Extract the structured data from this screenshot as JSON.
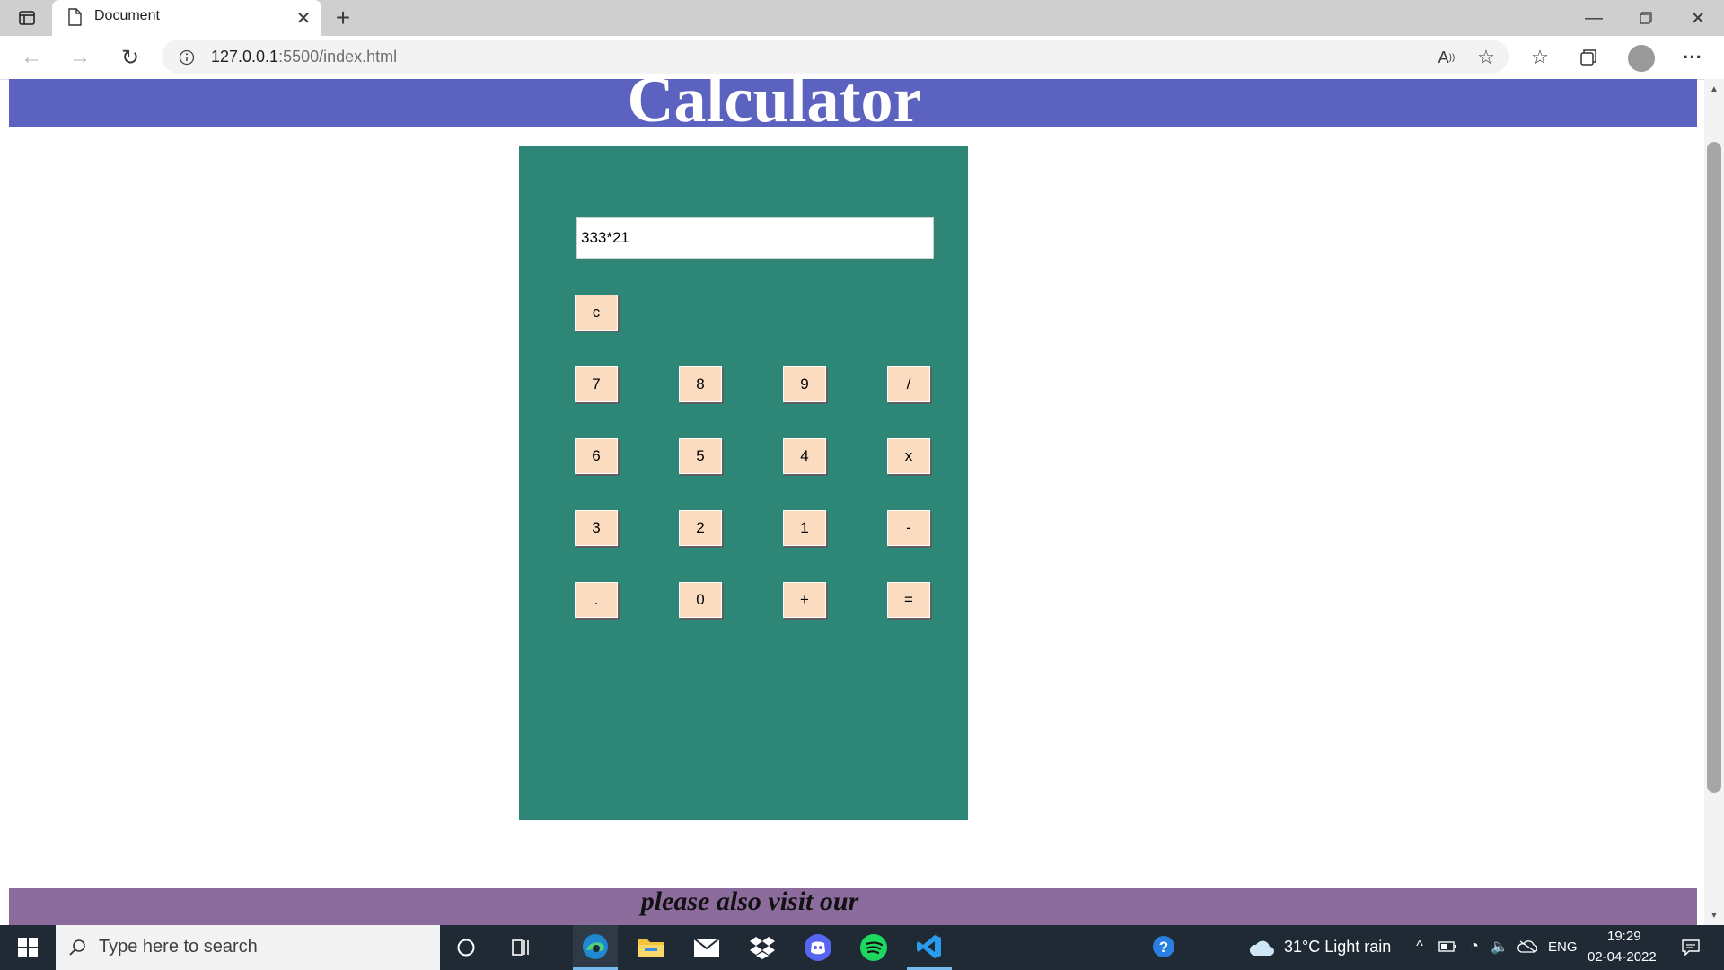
{
  "browser": {
    "tab_title": "Document",
    "url_host": "127.0.0.1",
    "url_path": ":5500/index.html"
  },
  "page": {
    "title": "Calculator",
    "footer_text": "please also visit our"
  },
  "calculator": {
    "display_value": "333*21",
    "clear_label": "c",
    "rows": [
      [
        "7",
        "8",
        "9",
        "/"
      ],
      [
        "6",
        "5",
        "4",
        "x"
      ],
      [
        "3",
        "2",
        "1",
        "-"
      ],
      [
        ".",
        "0",
        "+",
        "="
      ]
    ],
    "body_color": "#2e8677",
    "key_color": "#fbdcc0"
  },
  "taskbar": {
    "search_placeholder": "Type here to search",
    "weather": "31°C  Light rain",
    "language": "ENG",
    "time": "19:29",
    "date": "02-04-2022"
  }
}
